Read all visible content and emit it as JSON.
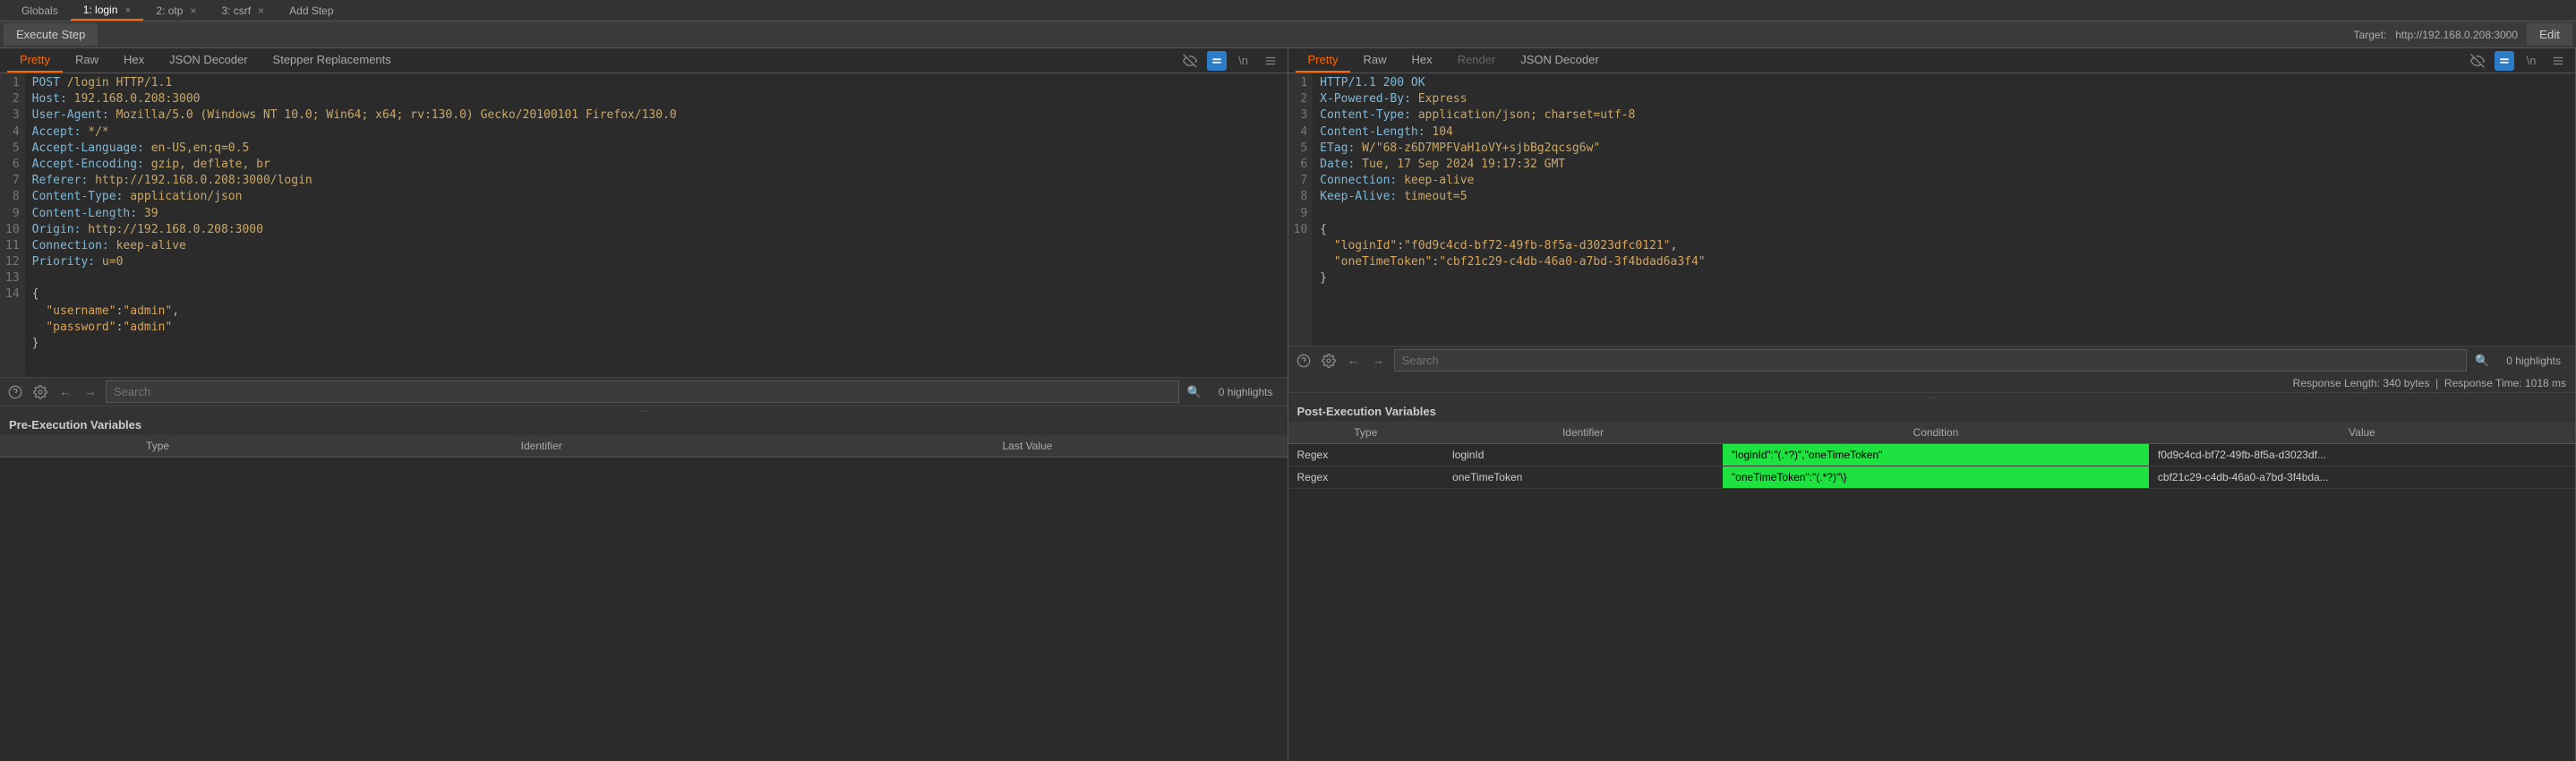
{
  "tabs": {
    "globals": "Globals",
    "t1": "1: login",
    "t2": "2: otp",
    "t3": "3: csrf",
    "add": "Add Step"
  },
  "toolbar": {
    "exec": "Execute Step",
    "target_label": "Target:",
    "target_url": "http://192.168.0.208:3000",
    "edit": "Edit"
  },
  "viewtabs": {
    "pretty": "Pretty",
    "raw": "Raw",
    "hex": "Hex",
    "json": "JSON Decoder",
    "stepper": "Stepper Replacements",
    "render": "Render"
  },
  "search": {
    "placeholder": "Search",
    "highlights": "0 highlights"
  },
  "request": {
    "gutters": [
      "1",
      "2",
      "3",
      "4",
      "5",
      "6",
      "7",
      "8",
      "9",
      "10",
      "11",
      "12",
      "13",
      "14"
    ],
    "l1a": "POST",
    "l1b": " /login HTTP/1.1",
    "l2a": "Host:",
    "l2b": " 192.168.0.208:3000",
    "l3a": "User-Agent:",
    "l3b": " Mozilla/5.0 (Windows NT 10.0; Win64; x64; rv:130.0) Gecko/20100101 Firefox/130.0",
    "l4a": "Accept:",
    "l4b": " */*",
    "l5a": "Accept-Language:",
    "l5b": " en-US,en;q=0.5",
    "l6a": "Accept-Encoding:",
    "l6b": " gzip, deflate, br",
    "l7a": "Referer:",
    "l7b": " http://192.168.0.208:3000/login",
    "l8a": "Content-Type:",
    "l8b": " application/json",
    "l9a": "Content-Length:",
    "l9b": " 39",
    "l10a": "Origin:",
    "l10b": " http://192.168.0.208:3000",
    "l11a": "Connection:",
    "l11b": " keep-alive",
    "l12a": "Priority:",
    "l12b": " u=0",
    "body_open": "{",
    "body_k1": "\"username\"",
    "body_v1": "\"admin\"",
    "body_k2": "\"password\"",
    "body_v2": "\"admin\"",
    "body_close": "}"
  },
  "response": {
    "gutters": [
      "1",
      "2",
      "3",
      "4",
      "5",
      "6",
      "7",
      "8",
      "9",
      "10"
    ],
    "l1": "HTTP/1.1 200 OK",
    "l2a": "X-Powered-By:",
    "l2b": " Express",
    "l3a": "Content-Type:",
    "l3b": " application/json; charset=utf-8",
    "l4a": "Content-Length:",
    "l4b": " 104",
    "l5a": "ETag:",
    "l5b": " W/\"68-z6D7MPFVaH1oVY+sjbBg2qcsg6w\"",
    "l6a": "Date:",
    "l6b": " Tue, 17 Sep 2024 19:17:32 GMT",
    "l7a": "Connection:",
    "l7b": " keep-alive",
    "l8a": "Keep-Alive:",
    "l8b": " timeout=5",
    "body_open": "{",
    "body_k1": "\"loginId\"",
    "body_v1": "\"f0d9c4cd-bf72-49fb-8f5a-d3023dfc0121\"",
    "body_k2": "\"oneTimeToken\"",
    "body_v2": "\"cbf21c29-c4db-46a0-a7bd-3f4bdad6a3f4\"",
    "body_close": "}"
  },
  "meta": {
    "resp_len_label": "Response Length:",
    "resp_len": "340 bytes",
    "resp_time_label": "Response Time:",
    "resp_time": "1018 ms"
  },
  "pre_vars": {
    "title": "Pre-Execution Variables",
    "headers": [
      "Type",
      "Identifier",
      "Last Value"
    ]
  },
  "post_vars": {
    "title": "Post-Execution Variables",
    "headers": [
      "Type",
      "Identifier",
      "Condition",
      "Value"
    ],
    "rows": [
      {
        "type": "Regex",
        "id": "loginId",
        "cond": "\"loginId\":\"(.*?)\",\"oneTimeToken\"",
        "val": "f0d9c4cd-bf72-49fb-8f5a-d3023df..."
      },
      {
        "type": "Regex",
        "id": "oneTimeToken",
        "cond": "\"oneTimeToken\":\"(.*?)\"\\}",
        "val": "cbf21c29-c4db-46a0-a7bd-3f4bda..."
      }
    ]
  }
}
